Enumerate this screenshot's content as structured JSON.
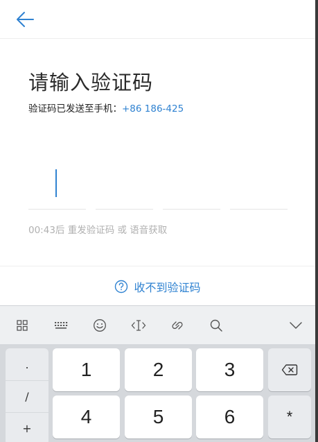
{
  "header": {
    "back_icon": "arrow-left-icon"
  },
  "main": {
    "title": "请输入验证码",
    "subtitle_prefix": "验证码已发送至手机：",
    "phone": "+86 186-425",
    "code_length": 4,
    "resend_text": "00:43后 重发验证码 或 语音获取",
    "help_text": "收不到验证码",
    "help_icon": "question-circle-icon"
  },
  "keyboard": {
    "toolbar_icons": [
      "grid-icon",
      "keyboard-icon",
      "emoji-icon",
      "cursor-move-icon",
      "clip-icon",
      "search-icon",
      "chevron-down-icon"
    ],
    "symbols": [
      ".",
      "/",
      "+"
    ],
    "keys_row1": [
      "1",
      "2",
      "3"
    ],
    "keys_row2": [
      "4",
      "5",
      "6"
    ],
    "backspace_icon": "backspace-icon",
    "star_key": "*"
  },
  "colors": {
    "accent": "#2f82d1",
    "muted": "#b0b0b0",
    "keyboard_bg": "#d5d8dc"
  }
}
